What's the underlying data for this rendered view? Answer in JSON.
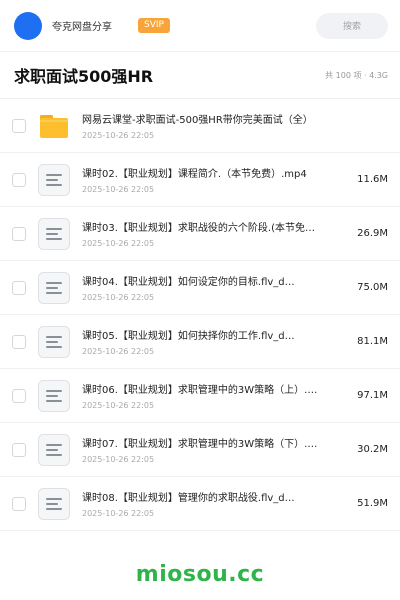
{
  "header": {
    "app_name": "夸克网盘分享",
    "svip_badge": "SVIP",
    "search_placeholder": "搜索"
  },
  "folder": {
    "title": "求职面试500强HR",
    "meta": "共 100 项 · 4.3G"
  },
  "colors": {
    "avatar": "#1f6ff2",
    "svip": "#f7a53a",
    "folder_icon": "#fdbf2d",
    "watermark": "#2fb44b"
  },
  "files": [
    {
      "type": "folder",
      "icon": "folder-icon",
      "name": "网易云课堂-求职面试-500强HR带你完美面试（全）",
      "date": "2025-10-26 22:05",
      "size": ""
    },
    {
      "type": "file",
      "icon": "document-icon",
      "name": "课时02.【职业规划】课程简介.（本节免费）.mp4",
      "date": "2025-10-26 22:05",
      "size": "11.6M"
    },
    {
      "type": "file",
      "icon": "document-icon",
      "name": "课时03.【职业规划】求职战役的六个阶段.(本节免…",
      "date": "2025-10-26 22:05",
      "size": "26.9M"
    },
    {
      "type": "file",
      "icon": "document-icon",
      "name": "课时04.【职业规划】如何设定你的目标.flv_d…",
      "date": "2025-10-26 22:05",
      "size": "75.0M"
    },
    {
      "type": "file",
      "icon": "document-icon",
      "name": "课时05.【职业规划】如何抉择你的工作.flv_d…",
      "date": "2025-10-26 22:05",
      "size": "81.1M"
    },
    {
      "type": "file",
      "icon": "document-icon",
      "name": "课时06.【职业规划】求职管理中的3W策略（上）.…",
      "date": "2025-10-26 22:05",
      "size": "97.1M"
    },
    {
      "type": "file",
      "icon": "document-icon",
      "name": "课时07.【职业规划】求职管理中的3W策略（下）.…",
      "date": "2025-10-26 22:05",
      "size": "30.2M"
    },
    {
      "type": "file",
      "icon": "document-icon",
      "name": "课时08.【职业规划】管理你的求职战役.flv_d…",
      "date": "2025-10-26 22:05",
      "size": "51.9M"
    }
  ],
  "watermark": "miosou.cc"
}
